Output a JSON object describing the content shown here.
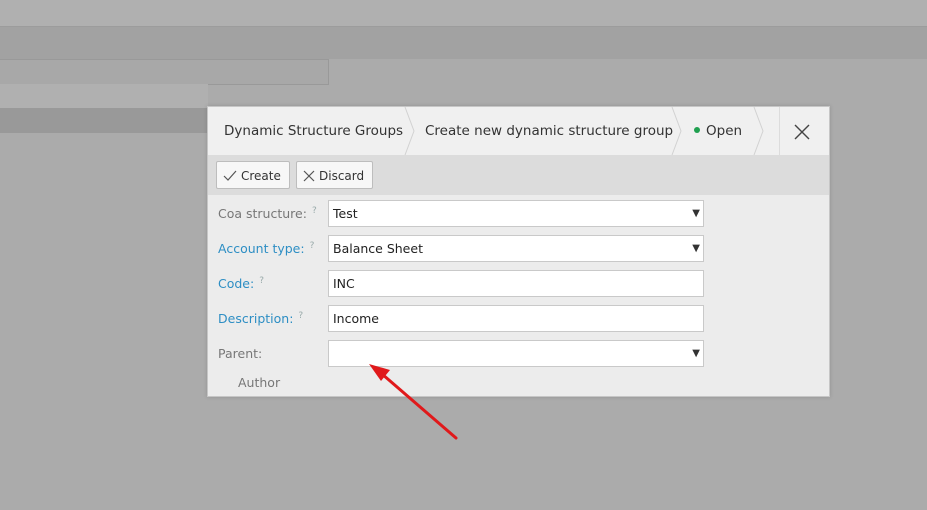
{
  "breadcrumb": {
    "items": [
      "Dynamic Structure Groups",
      "Create new dynamic structure group"
    ],
    "status": "Open"
  },
  "toolbar": {
    "create_label": "Create",
    "discard_label": "Discard"
  },
  "form": {
    "coa_structure": {
      "label": "Coa structure:",
      "value": "Test"
    },
    "account_type": {
      "label": "Account type:",
      "value": "Balance Sheet"
    },
    "code": {
      "label": "Code:",
      "value": "INC"
    },
    "description": {
      "label": "Description:",
      "value": "Income"
    },
    "parent": {
      "label": "Parent:",
      "value": ""
    },
    "help_mark": "?",
    "dropdown_arrow": "▼"
  },
  "section": {
    "author_label": "Author"
  },
  "colors": {
    "required_label": "#2d8ec4",
    "status_dot": "#20a050",
    "annotation_arrow": "#e0191b"
  },
  "icons": [
    "check-icon",
    "close-x-icon",
    "chevron-separator-icon",
    "dropdown-arrow-icon",
    "help-icon",
    "annotation-arrow"
  ]
}
